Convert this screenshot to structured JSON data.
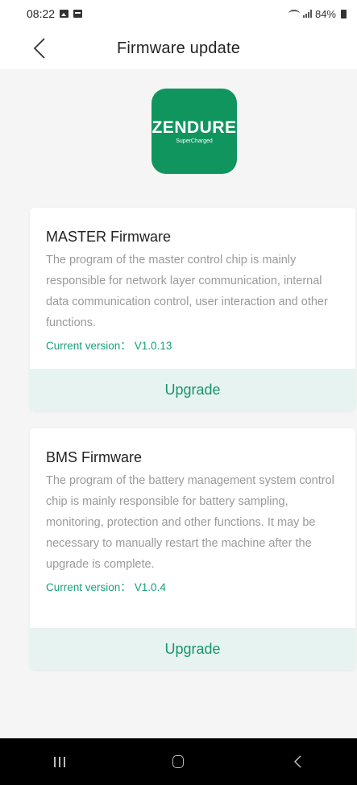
{
  "status_bar": {
    "time": "08:22",
    "battery": "84%"
  },
  "header": {
    "title": "Firmware update"
  },
  "logo": {
    "brand": "ZENDURE",
    "tagline": "SuperCharged",
    "color": "#10955e"
  },
  "firmwares": [
    {
      "title": "MASTER Firmware",
      "description": "The program of the master control chip is mainly responsible for network layer communication, internal data communication control, user interaction and other functions.",
      "version_label": "Current version：",
      "version_value": "V1.0.13",
      "upgrade_label": "Upgrade"
    },
    {
      "title": "BMS Firmware",
      "description": "The program of the battery management system control chip is mainly responsible for battery sampling, monitoring, protection and other functions. It may be necessary to manually restart the machine after the upgrade is complete.",
      "version_label": "Current version：",
      "version_value": "V1.0.4",
      "upgrade_label": "Upgrade"
    }
  ],
  "colors": {
    "accent": "#17a07a",
    "button_bg": "#e7f3f0",
    "page_bg": "#f5f5f5"
  },
  "icons": {
    "back": "chevron-left-icon",
    "nav_recents": "recents-icon",
    "nav_home": "home-icon",
    "nav_back": "nav-back-icon"
  }
}
